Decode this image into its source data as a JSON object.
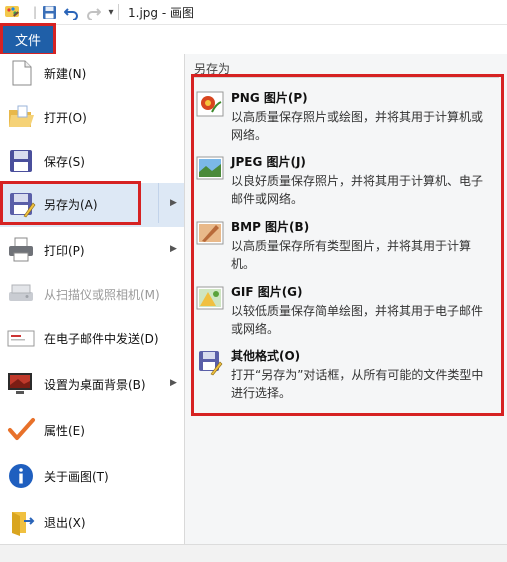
{
  "titlebar": {
    "title": "1.jpg - 画图",
    "save_icon": "save-icon",
    "undo_icon": "undo-icon",
    "redo_icon": "redo-icon",
    "customize_icon": "chevron-down-icon"
  },
  "file_tab": {
    "label": "文件"
  },
  "menu": {
    "items": [
      {
        "label": "新建(N)",
        "icon": "new-document-icon",
        "has_submenu": false,
        "enabled": true
      },
      {
        "label": "打开(O)",
        "icon": "open-folder-icon",
        "has_submenu": false,
        "enabled": true
      },
      {
        "label": "保存(S)",
        "icon": "save-icon",
        "has_submenu": false,
        "enabled": true
      },
      {
        "label": "另存为(A)",
        "icon": "save-as-icon",
        "has_submenu": true,
        "enabled": true,
        "selected": true
      },
      {
        "label": "打印(P)",
        "icon": "printer-icon",
        "has_submenu": true,
        "enabled": true
      },
      {
        "label": "从扫描仪或照相机(M)",
        "icon": "scanner-icon",
        "has_submenu": false,
        "enabled": false
      },
      {
        "label": "在电子邮件中发送(D)",
        "icon": "email-icon",
        "has_submenu": false,
        "enabled": true
      },
      {
        "label": "设置为桌面背景(B)",
        "icon": "desktop-background-icon",
        "has_submenu": true,
        "enabled": true
      },
      {
        "label": "属性(E)",
        "icon": "checkmark-icon",
        "has_submenu": false,
        "enabled": true
      },
      {
        "label": "关于画图(T)",
        "icon": "info-icon",
        "has_submenu": false,
        "enabled": true
      },
      {
        "label": "退出(X)",
        "icon": "exit-icon",
        "has_submenu": false,
        "enabled": true
      }
    ]
  },
  "save_as_panel": {
    "title": "另存为",
    "options": [
      {
        "name": "PNG 图片(P)",
        "description": "以高质量保存照片或绘图，并将其用于计算机或网络。",
        "icon": "png-image-icon"
      },
      {
        "name": "JPEG 图片(J)",
        "description": "以良好质量保存照片，并将其用于计算机、电子邮件或网络。",
        "icon": "jpeg-image-icon"
      },
      {
        "name": "BMP 图片(B)",
        "description": "以高质量保存所有类型图片，并将其用于计算机。",
        "icon": "bmp-image-icon"
      },
      {
        "name": "GIF 图片(G)",
        "description": "以较低质量保存简单绘图，并将其用于电子邮件或网络。",
        "icon": "gif-image-icon"
      },
      {
        "name": "其他格式(O)",
        "description": "打开“另存为”对话框，从所有可能的文件类型中进行选择。",
        "icon": "other-formats-icon"
      }
    ]
  },
  "colors": {
    "file_tab": "#1f5fa8",
    "highlight": "#d62222",
    "panel_bg": "#f5f6f7"
  }
}
